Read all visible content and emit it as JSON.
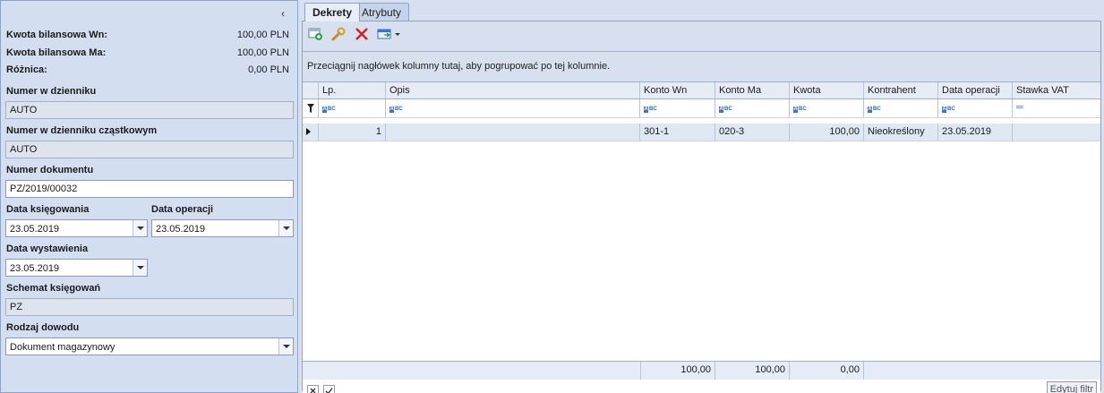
{
  "summary": {
    "wn_label": "Kwota bilansowa Wn:",
    "wn_value": "100,00 PLN",
    "ma_label": "Kwota bilansowa Ma:",
    "ma_value": "100,00 PLN",
    "diff_label": "Różnica:",
    "diff_value": "0,00 PLN"
  },
  "form": {
    "journal_number_label": "Numer w dzienniku",
    "journal_number_value": "AUTO",
    "partial_journal_label": "Numer w dzienniku cząstkowym",
    "partial_journal_value": "AUTO",
    "document_number_label": "Numer dokumentu",
    "document_number_value": "PZ/2019/00032",
    "posting_date_label": "Data księgowania",
    "posting_date_value": "23.05.2019",
    "operation_date_label": "Data operacji",
    "operation_date_value": "23.05.2019",
    "issue_date_label": "Data wystawienia",
    "issue_date_value": "23.05.2019",
    "scheme_label": "Schemat księgowań",
    "scheme_value": "PZ",
    "proof_type_label": "Rodzaj dowodu",
    "proof_type_value": "Dokument magazynowy"
  },
  "tabs": [
    {
      "label": "Dekrety",
      "active": true
    },
    {
      "label": "Atrybuty",
      "active": false
    }
  ],
  "toolbar": {
    "icons": [
      "add-entry-icon",
      "edit-wrench-icon",
      "delete-x-icon",
      "export-dropdown-icon"
    ]
  },
  "grid": {
    "group_hint": "Przeciągnij nagłówek kolumny tutaj, aby pogrupować po tej kolumnie.",
    "columns": [
      "Lp.",
      "Opis",
      "Konto Wn",
      "Konto Ma",
      "Kwota",
      "Kontrahent",
      "Data operacji",
      "Stawka VAT"
    ],
    "filter_glyph": "ABC",
    "rows": [
      {
        "lp": "1",
        "opis": "",
        "konto_wn": "301-1",
        "konto_ma": "020-3",
        "kwota": "100,00",
        "kontrahent": "Nieokreślony",
        "data_operacji": "23.05.2019",
        "stawka_vat": ""
      }
    ],
    "totals": {
      "wn": "100,00",
      "ma": "100,00",
      "kwota": "0,00"
    },
    "edit_filter_label": "Edytuj filtr"
  },
  "colors": {
    "accent": "#3a72d6",
    "delete": "#d42020",
    "panel": "#d3dff0"
  }
}
